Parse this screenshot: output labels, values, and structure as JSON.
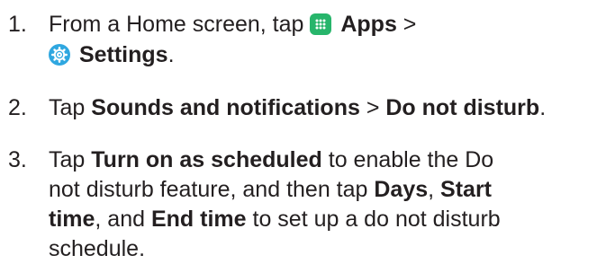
{
  "steps": [
    {
      "number": "1.",
      "lines": [
        {
          "text_1": "From a Home screen, tap ",
          "icon": "apps-grid-icon",
          "text_2": " ",
          "bold_1": "Apps",
          "text_3": " >"
        },
        {
          "icon": "settings-gear-icon",
          "text_1": " ",
          "bold_1": "Settings",
          "text_2": "."
        }
      ]
    },
    {
      "number": "2.",
      "lines": [
        {
          "text_1": "Tap ",
          "bold_1": "Sounds and notifications",
          "text_2": " > ",
          "bold_2": "Do not disturb",
          "text_3": "."
        }
      ]
    },
    {
      "number": "3.",
      "lines": [
        {
          "text_1": "Tap ",
          "bold_1": "Turn on as scheduled",
          "text_2": " to enable the Do"
        },
        {
          "text_1": "not disturb feature, and then tap ",
          "bold_1": "Days",
          "text_2": ", ",
          "bold_2": "Start"
        },
        {
          "bold_1": "time",
          "text_1": ", and ",
          "bold_2": "End time",
          "text_2": " to set up a do not disturb"
        },
        {
          "text_1": "schedule."
        }
      ]
    }
  ],
  "colors": {
    "text": "#231f20",
    "apps_icon": "#27b56b",
    "settings_icon": "#2fa7e0"
  }
}
